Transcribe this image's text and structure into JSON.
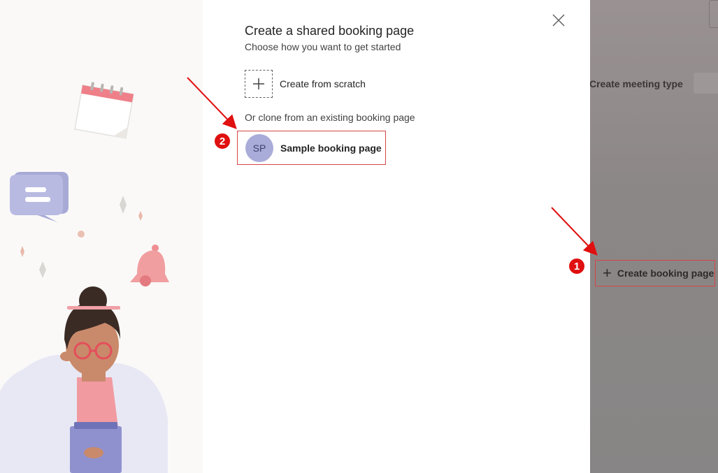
{
  "dialog": {
    "title": "Create a shared booking page",
    "subtitle": "Choose how you want to get started",
    "scratch_label": "Create from scratch",
    "clone_label": "Or clone from an existing booking page",
    "sample": {
      "initials": "SP",
      "label": "Sample booking page"
    }
  },
  "background": {
    "create_meeting_type": "Create meeting type",
    "create_booking_page": "Create booking page"
  },
  "annotations": {
    "marker_1": "1",
    "marker_2": "2"
  },
  "colors": {
    "highlight": "#d64545",
    "marker": "#e01010",
    "avatar": "#a9acd8"
  }
}
